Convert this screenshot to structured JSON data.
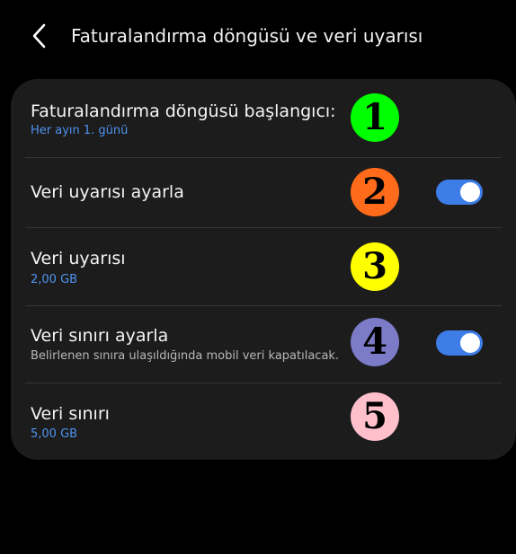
{
  "header": {
    "title": "Faturalandırma döngüsü ve veri uyarısı",
    "back_icon": "chevron-left-icon"
  },
  "settings": {
    "billing_cycle": {
      "title": "Faturalandırma döngüsü başlangıcı:",
      "value": "Her ayın 1. günü",
      "badge": "1",
      "badge_color": "#00ff00"
    },
    "set_data_warning": {
      "title": "Veri uyarısı ayarla",
      "badge": "2",
      "badge_color": "#ff6b1a",
      "toggle_on": true
    },
    "data_warning": {
      "title": "Veri uyarısı",
      "value": "2,00 GB",
      "badge": "3",
      "badge_color": "#ffff00"
    },
    "set_data_limit": {
      "title": "Veri sınırı ayarla",
      "description": "Belirlenen sınıra ulaşıldığında mobil veri kapatılacak.",
      "badge": "4",
      "badge_color": "#7b7bc8",
      "toggle_on": true
    },
    "data_limit": {
      "title": "Veri sınırı",
      "value": "5,00 GB",
      "badge": "5",
      "badge_color": "#ffc0cb"
    }
  },
  "colors": {
    "background": "#000000",
    "card": "#1c1c1c",
    "accent_blue": "#4f93f0",
    "toggle_on": "#3e7de8",
    "divider": "#353535"
  }
}
